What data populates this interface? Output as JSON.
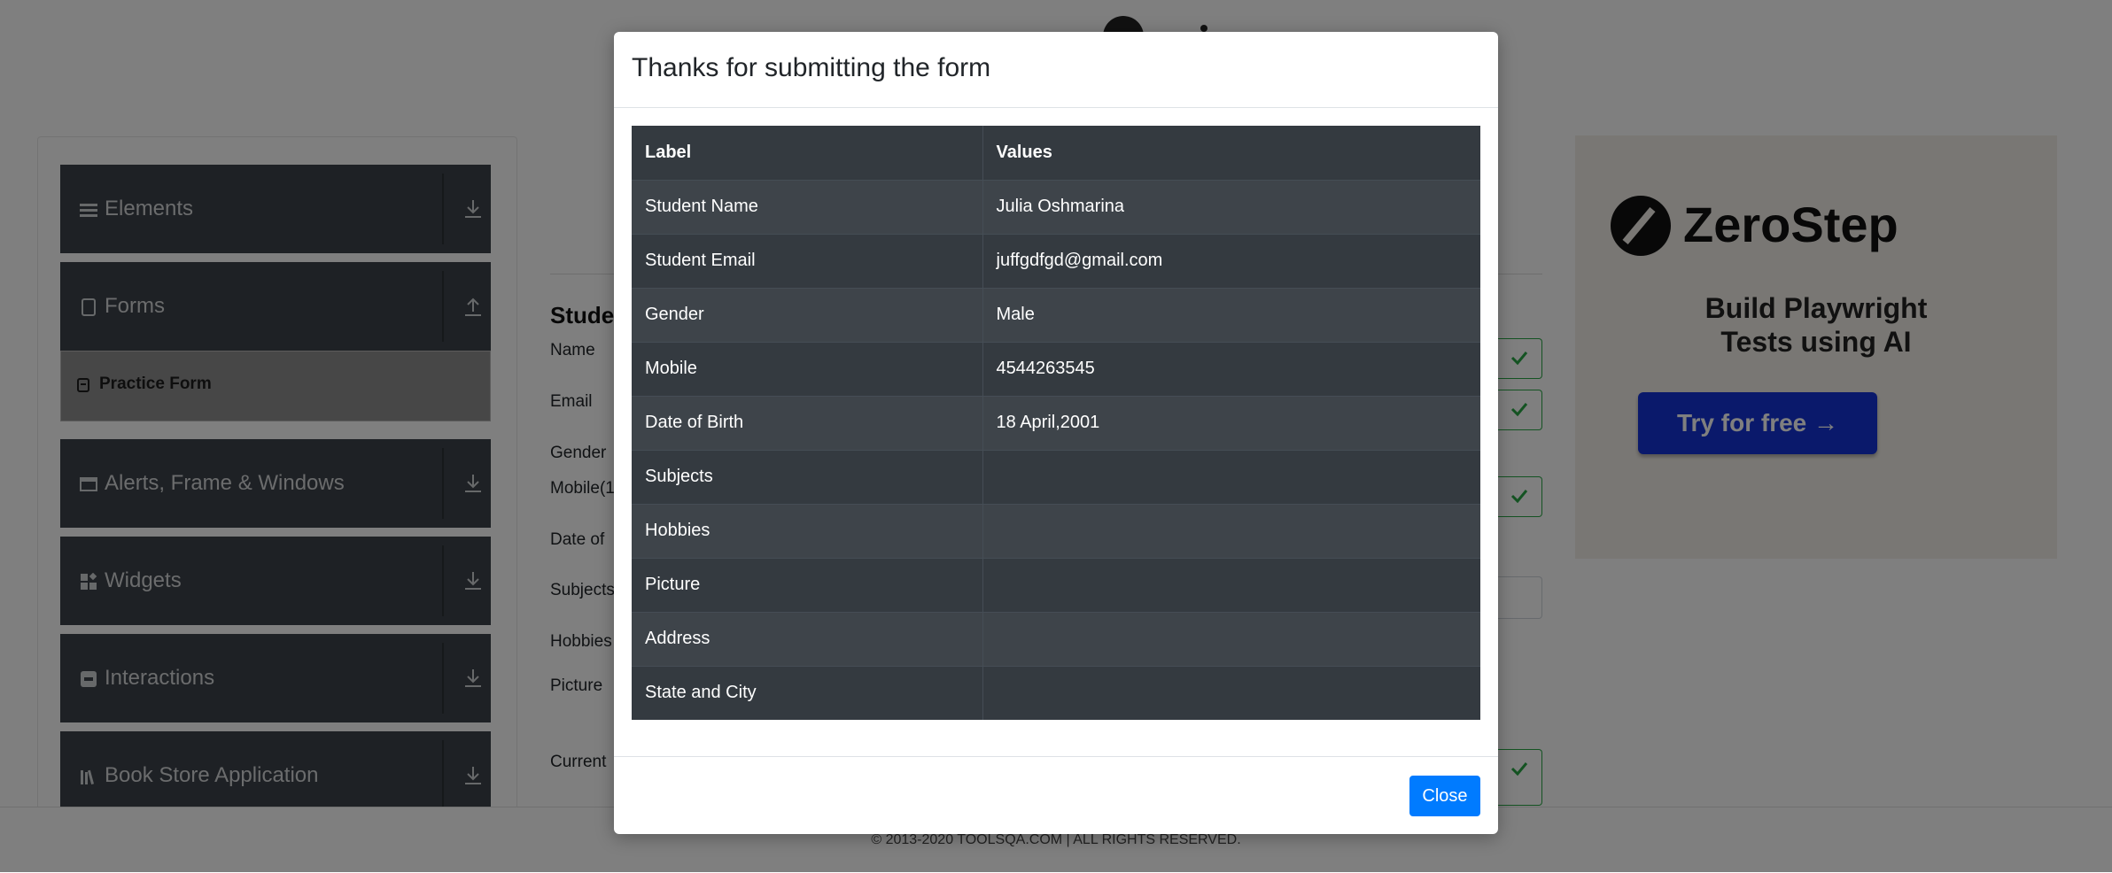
{
  "sidebar": {
    "groups": [
      {
        "label": "Elements",
        "icon": "hamburger-icon",
        "arrow": "download-arrow-icon"
      },
      {
        "label": "Forms",
        "icon": "document-icon",
        "arrow": "upload-arrow-icon"
      },
      {
        "label": "Alerts, Frame & Windows",
        "icon": "window-icon",
        "arrow": "download-arrow-icon"
      },
      {
        "label": "Widgets",
        "icon": "widgets-icon",
        "arrow": "download-arrow-icon"
      },
      {
        "label": "Interactions",
        "icon": "interactions-icon",
        "arrow": "download-arrow-icon"
      },
      {
        "label": "Book Store Application",
        "icon": "books-icon",
        "arrow": "download-arrow-icon"
      }
    ],
    "active_item": {
      "label": "Practice Form",
      "icon": "form-icon"
    }
  },
  "form": {
    "title": "Studer",
    "labels": [
      "Name",
      "Email",
      "Gender",
      "Mobile(1",
      "Date of",
      "Subjects",
      "Hobbies",
      "Picture",
      "Current"
    ]
  },
  "ad": {
    "brand": "ZeroStep",
    "headline_line1": "Build Playwright",
    "headline_line2": "Tests using AI",
    "cta": "Try for free →"
  },
  "footer": {
    "copyright": "© 2013-2020 TOOLSQA.COM | ALL RIGHTS RESERVED."
  },
  "modal": {
    "title": "Thanks for submitting the form",
    "table": {
      "headers": [
        "Label",
        "Values"
      ],
      "rows": [
        [
          "Student Name",
          "Julia Oshmarina"
        ],
        [
          "Student Email",
          "juffgdfgd@gmail.com"
        ],
        [
          "Gender",
          "Male"
        ],
        [
          "Mobile",
          "4544263545"
        ],
        [
          "Date of Birth",
          "18 April,2001"
        ],
        [
          "Subjects",
          ""
        ],
        [
          "Hobbies",
          ""
        ],
        [
          "Picture",
          ""
        ],
        [
          "Address",
          ""
        ],
        [
          "State and City",
          ""
        ]
      ]
    },
    "close_label": "Close"
  },
  "colors": {
    "overlay": "rgba(0,0,0,0.5)",
    "table_dark": "#343a40",
    "table_striped": "#3e444a",
    "primary": "#007bff",
    "success": "#28a745",
    "ad_button": "#1433d6"
  }
}
